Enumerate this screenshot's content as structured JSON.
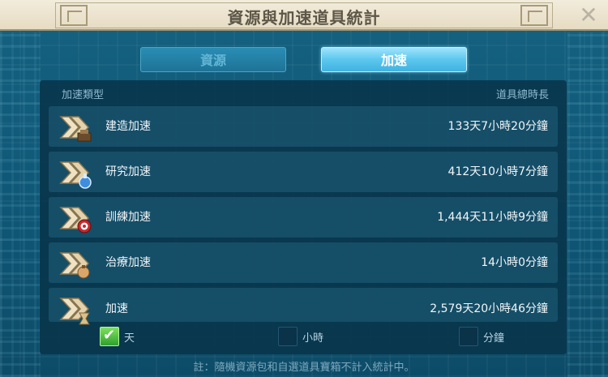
{
  "window": {
    "title": "資源與加速道具統計",
    "close_symbol": "✕"
  },
  "tabs": [
    {
      "label": "資源",
      "selected": false
    },
    {
      "label": "加速",
      "selected": true
    }
  ],
  "table": {
    "header_type": "加速類型",
    "header_total": "道具總時長",
    "rows": [
      {
        "label": "建造加速",
        "value": "133天7小時20分鐘",
        "icon": "construction-speedup-icon"
      },
      {
        "label": "研究加速",
        "value": "412天10小時7分鐘",
        "icon": "research-speedup-icon"
      },
      {
        "label": "訓練加速",
        "value": "1,444天11小時9分鐘",
        "icon": "training-speedup-icon"
      },
      {
        "label": "治療加速",
        "value": "14小時0分鐘",
        "icon": "healing-speedup-icon"
      },
      {
        "label": "加速",
        "value": "2,579天20小時46分鐘",
        "icon": "universal-speedup-icon"
      }
    ]
  },
  "units": [
    {
      "label": "天",
      "checked": true
    },
    {
      "label": "小時",
      "checked": false
    },
    {
      "label": "分鐘",
      "checked": false
    }
  ],
  "footnote": "註：隨機資源包和自選道具寶箱不計入統計中。",
  "colors": {
    "background": "#0f5470",
    "active_tab": "#5cc7ee",
    "checkbox_checked": "#2ea12e",
    "title_bar": "#ece4cf"
  }
}
